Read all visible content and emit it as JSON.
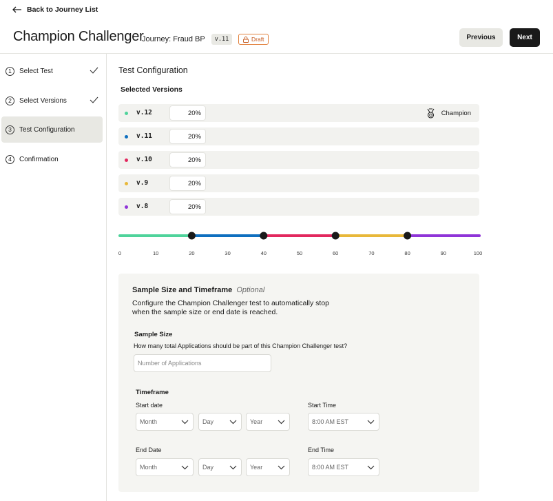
{
  "header": {
    "back_label": "Back to Journey List",
    "title": "Champion Challenger",
    "journey_label": "Journey: Fraud BP",
    "version_badge": "v.11",
    "status_badge": "Draft",
    "prev_label": "Previous",
    "next_label": "Next"
  },
  "steps": [
    {
      "num": "1",
      "label": "Select Test",
      "done": true
    },
    {
      "num": "2",
      "label": "Select Versions",
      "done": true
    },
    {
      "num": "3",
      "label": "Test Configuration",
      "active": true
    },
    {
      "num": "4",
      "label": "Confirmation"
    }
  ],
  "main": {
    "section_title": "Test Configuration",
    "selected_title": "Selected Versions",
    "versions": [
      {
        "name": "v.12",
        "percent": "20%",
        "color": "#4fd39b",
        "champion_label": "Champion"
      },
      {
        "name": "v.11",
        "percent": "20%",
        "color": "#0f6fbf"
      },
      {
        "name": "v.10",
        "percent": "20%",
        "color": "#e2285e"
      },
      {
        "name": "v.9",
        "percent": "20%",
        "color": "#e8b83a"
      },
      {
        "name": "v.8",
        "percent": "20%",
        "color": "#8f34d8"
      }
    ],
    "split": {
      "ticks": [
        "0",
        "10",
        "20",
        "30",
        "40",
        "50",
        "60",
        "70",
        "80",
        "90",
        "100"
      ],
      "handles": [
        20,
        40,
        60,
        80
      ]
    }
  },
  "panel": {
    "title": "Sample Size and Timeframe",
    "optional": "Optional",
    "description": "Configure the Champion Challenger test to automatically stop when the sample size or end date is reached.",
    "sample_size_label": "Sample Size",
    "sample_size_question": "How many total Applications should be part of this Champion Challenger test?",
    "sample_size_placeholder": "Number of Applications",
    "timeframe_label": "Timeframe",
    "start_date_label": "Start date",
    "start_time_label": "Start Time",
    "end_date_label": "End Date",
    "end_time_label": "End Time",
    "month": "Month",
    "day": "Day",
    "year": "Year",
    "time": "8:00 AM EST"
  }
}
